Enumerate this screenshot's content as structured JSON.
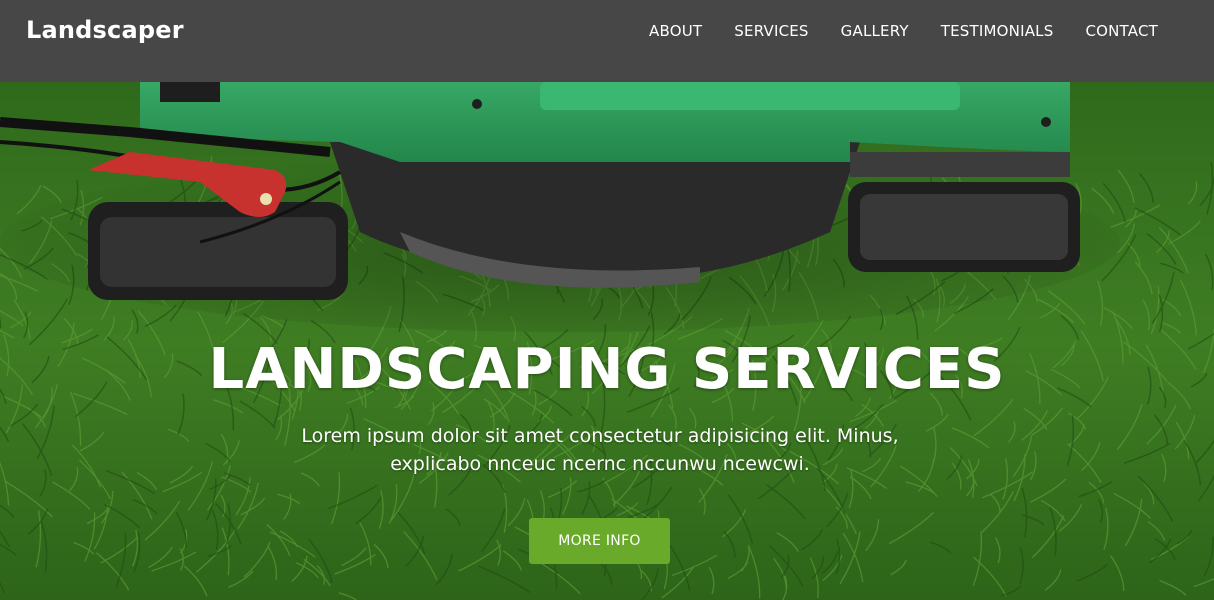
{
  "brand": "Landscaper",
  "nav": [
    "ABOUT",
    "SERVICES",
    "GALLERY",
    "TESTIMONIALS",
    "CONTACT"
  ],
  "hero": {
    "title": "LANDSCAPING SERVICES",
    "subtitle_line1": "Lorem ipsum dolor sit amet consectetur adipisicing elit. Minus,",
    "subtitle_line2": "explicabo nnceuc ncernc nccunwu ncewcwi.",
    "button": "MORE INFO"
  },
  "colors": {
    "navbar": "#474747",
    "cta": "#6aaa2a",
    "mower_green": "#2f9a5a",
    "grass": "#3d7a23"
  }
}
